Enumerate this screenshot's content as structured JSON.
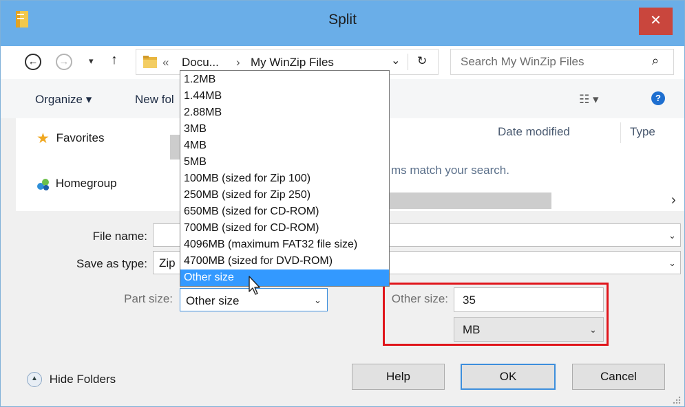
{
  "window": {
    "title": "Split",
    "close_glyph": "✕",
    "accent_color": "#6aaee8"
  },
  "nav": {
    "back_glyph": "←",
    "forward_glyph": "→",
    "recent_glyph": "▾",
    "up_glyph": "↑"
  },
  "address": {
    "overflow_glyph": "«",
    "crumbs": [
      "Docu...",
      "My WinZip Files"
    ],
    "separator": "›",
    "dropdown_glyph": "⌄",
    "refresh_glyph": "↻"
  },
  "search": {
    "placeholder": "Search My WinZip Files",
    "icon_glyph": "⌕"
  },
  "toolbar": {
    "organize_label": "Organize ▾",
    "new_folder_label": "New fol",
    "view_glyph": "☷ ▾",
    "help_glyph": "?"
  },
  "navpane": {
    "favorites_label": "Favorites",
    "homegroup_label": "Homegroup"
  },
  "content": {
    "columns": [
      "Date modified",
      "Type"
    ],
    "empty_message": "ms match your search.",
    "scroll_right_glyph": "›"
  },
  "form": {
    "file_name_label": "File name:",
    "file_name_value": "",
    "save_as_type_label": "Save as type:",
    "save_as_type_value": "Zip",
    "part_size_label": "Part size:",
    "part_size_value": "Other size",
    "other_size_label": "Other size:",
    "other_size_value": "35",
    "unit_value": "MB"
  },
  "part_size_options": [
    "1.2MB",
    "1.44MB",
    "2.88MB",
    "3MB",
    "4MB",
    "5MB",
    "100MB (sized for Zip 100)",
    "250MB (sized for Zip 250)",
    "650MB (sized for CD-ROM)",
    "700MB (sized for CD-ROM)",
    "4096MB (maximum FAT32 file size)",
    "4700MB (sized for DVD-ROM)",
    "Other size"
  ],
  "selected_option_index": 12,
  "footer": {
    "hide_folders_label": "Hide Folders",
    "help_label": "Help",
    "ok_label": "OK",
    "cancel_label": "Cancel"
  },
  "highlight_color": "#e0151b"
}
